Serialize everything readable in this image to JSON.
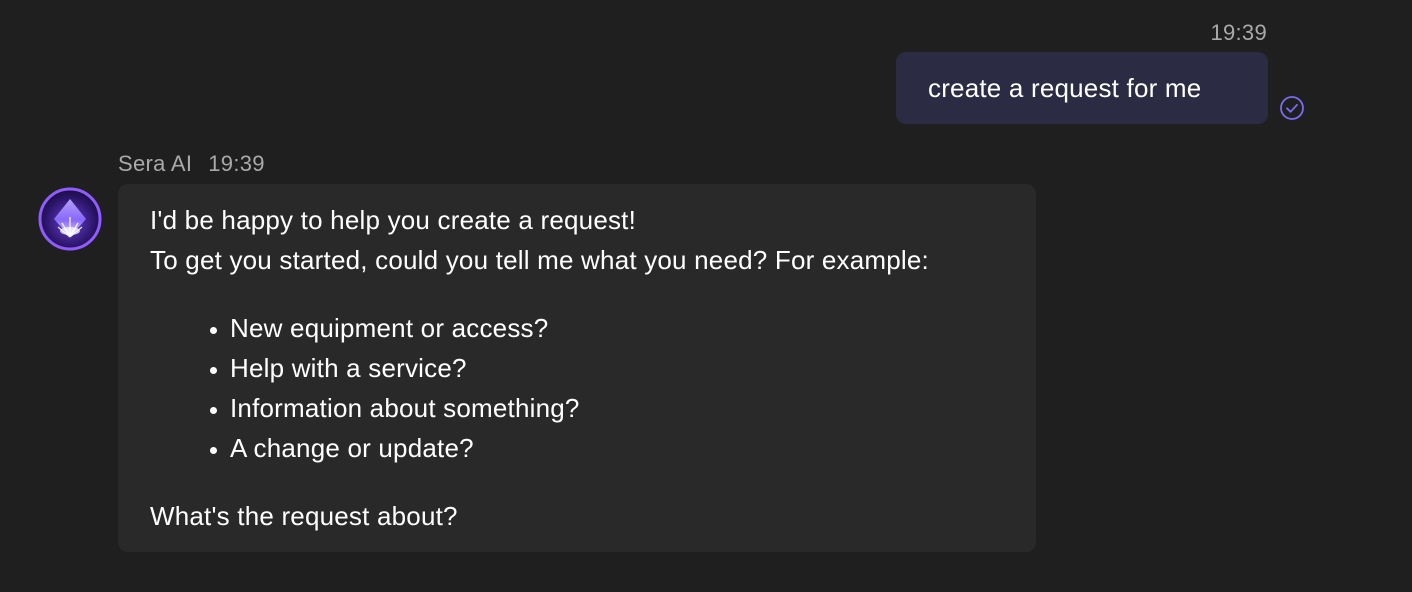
{
  "outgoing": {
    "time": "19:39",
    "text": "create a request for me",
    "status_icon": "check-circle-icon"
  },
  "incoming": {
    "sender": "Sera AI",
    "time": "19:39",
    "avatar_icon": "sera-ai-logo",
    "intro_line_1": "I'd be happy to help you create a request!",
    "intro_line_2": "To get you started, could you tell me what you need? For example:",
    "examples": [
      "New equipment or access?",
      "Help with a service?",
      "Information about something?",
      "A change or update?"
    ],
    "closing": "What's the request about?"
  },
  "colors": {
    "background": "#1f1f1f",
    "outgoing_bubble": "#2b2b44",
    "incoming_bubble": "#292929",
    "accent": "#7b6cf6"
  }
}
